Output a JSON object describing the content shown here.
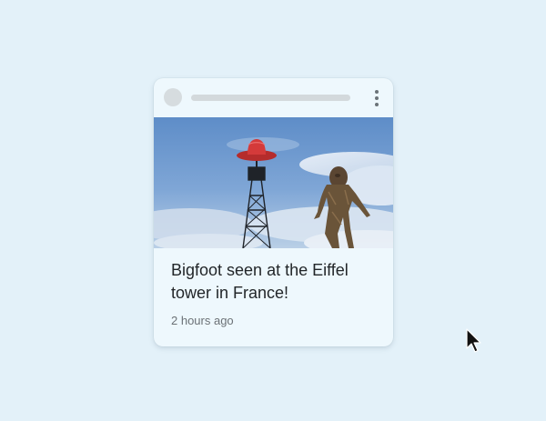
{
  "card": {
    "headline": "Bigfoot seen at the Eiffel tower in France!",
    "timestamp": "2 hours ago",
    "image": "bigfoot-eiffel-tower-photo",
    "menu_icon": "more-vert-icon"
  },
  "colors": {
    "background": "#e3f1f9",
    "card": "#eef8fd",
    "sky": "#6f9bd0",
    "hat": "#d43a3a",
    "headline_text": "#222629",
    "timestamp_text": "#6b7176"
  }
}
